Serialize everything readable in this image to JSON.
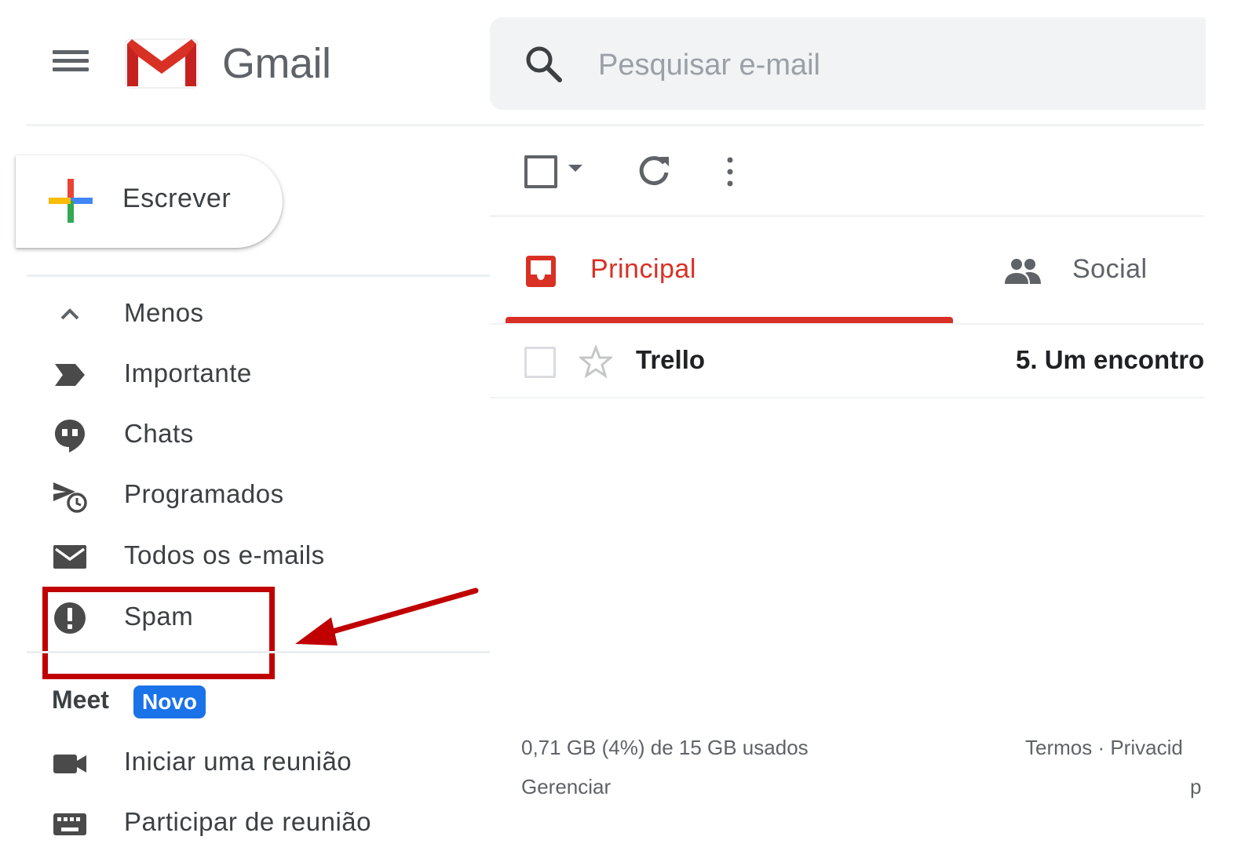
{
  "header": {
    "brand": "Gmail",
    "search_placeholder": "Pesquisar e-mail"
  },
  "compose": {
    "label": "Escrever"
  },
  "nav": {
    "items": [
      {
        "label": "Menos",
        "icon": "chevron-up-icon"
      },
      {
        "label": "Importante",
        "icon": "label-important-icon"
      },
      {
        "label": "Chats",
        "icon": "chat-icon"
      },
      {
        "label": "Programados",
        "icon": "scheduled-send-icon"
      },
      {
        "label": "Todos os e-mails",
        "icon": "mail-icon"
      },
      {
        "label": "Spam",
        "icon": "report-icon"
      }
    ]
  },
  "meet": {
    "title": "Meet",
    "badge": "Novo",
    "items": [
      {
        "label": "Iniciar uma reunião",
        "icon": "videocam-icon"
      },
      {
        "label": "Participar de reunião",
        "icon": "keyboard-icon"
      }
    ]
  },
  "tabs": [
    {
      "label": "Principal",
      "icon": "inbox-icon",
      "active": true,
      "color": "#d93025"
    },
    {
      "label": "Social",
      "icon": "people-icon",
      "active": false
    }
  ],
  "emails": [
    {
      "sender": "Trello",
      "subject": "5. Um encontro"
    }
  ],
  "footer": {
    "storage": "0,71 GB (4%) de 15 GB usados",
    "manage": "Gerenciar",
    "links": "Termos · Privacid",
    "links_cut": "p"
  },
  "annotation": {
    "highlight_color": "#c00000",
    "target": "Spam"
  }
}
